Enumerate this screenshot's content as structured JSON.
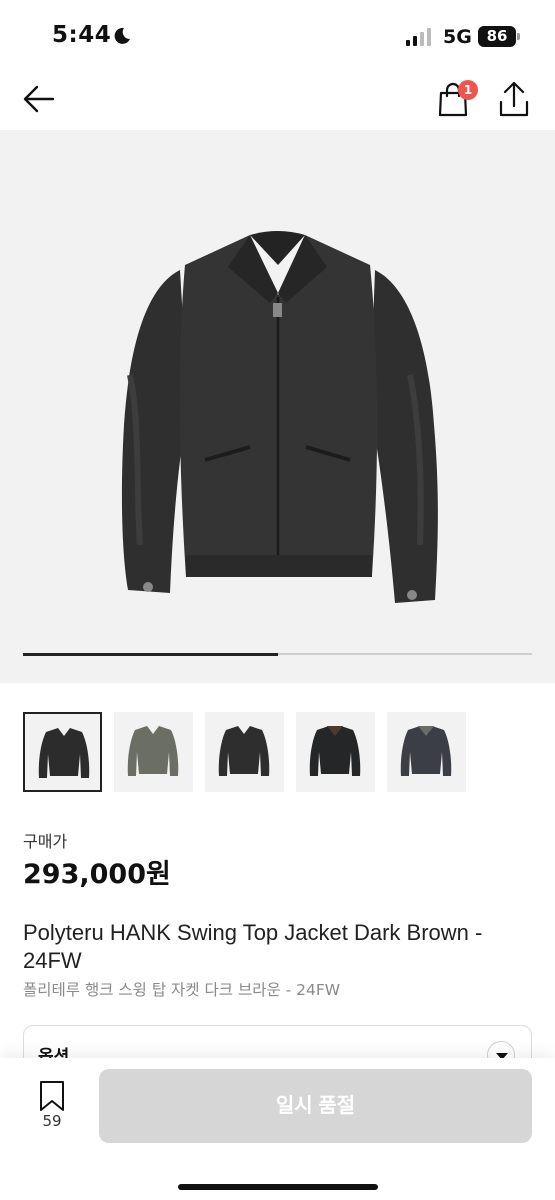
{
  "status_bar": {
    "time": "5:44",
    "network": "5G",
    "battery": "86"
  },
  "header": {
    "cart_count": "1"
  },
  "gallery": {
    "progress": 0.5,
    "selected_index": 0,
    "thumbnail_count": 5
  },
  "product": {
    "price_label": "구매가",
    "price": "293,000원",
    "title": "Polyteru HANK Swing Top Jacket Dark Brown - 24FW",
    "subtitle": "폴리테루 행크 스윙 탑 자켓 다크 브라운 - 24FW"
  },
  "option": {
    "label": "옵션"
  },
  "bottom_bar": {
    "bookmark_count": "59",
    "action_label": "일시 품절"
  },
  "colors": {
    "accent_badge": "#f0544f",
    "disabled_button": "#d6d6d6",
    "hero_bg": "#f2f2f2"
  }
}
